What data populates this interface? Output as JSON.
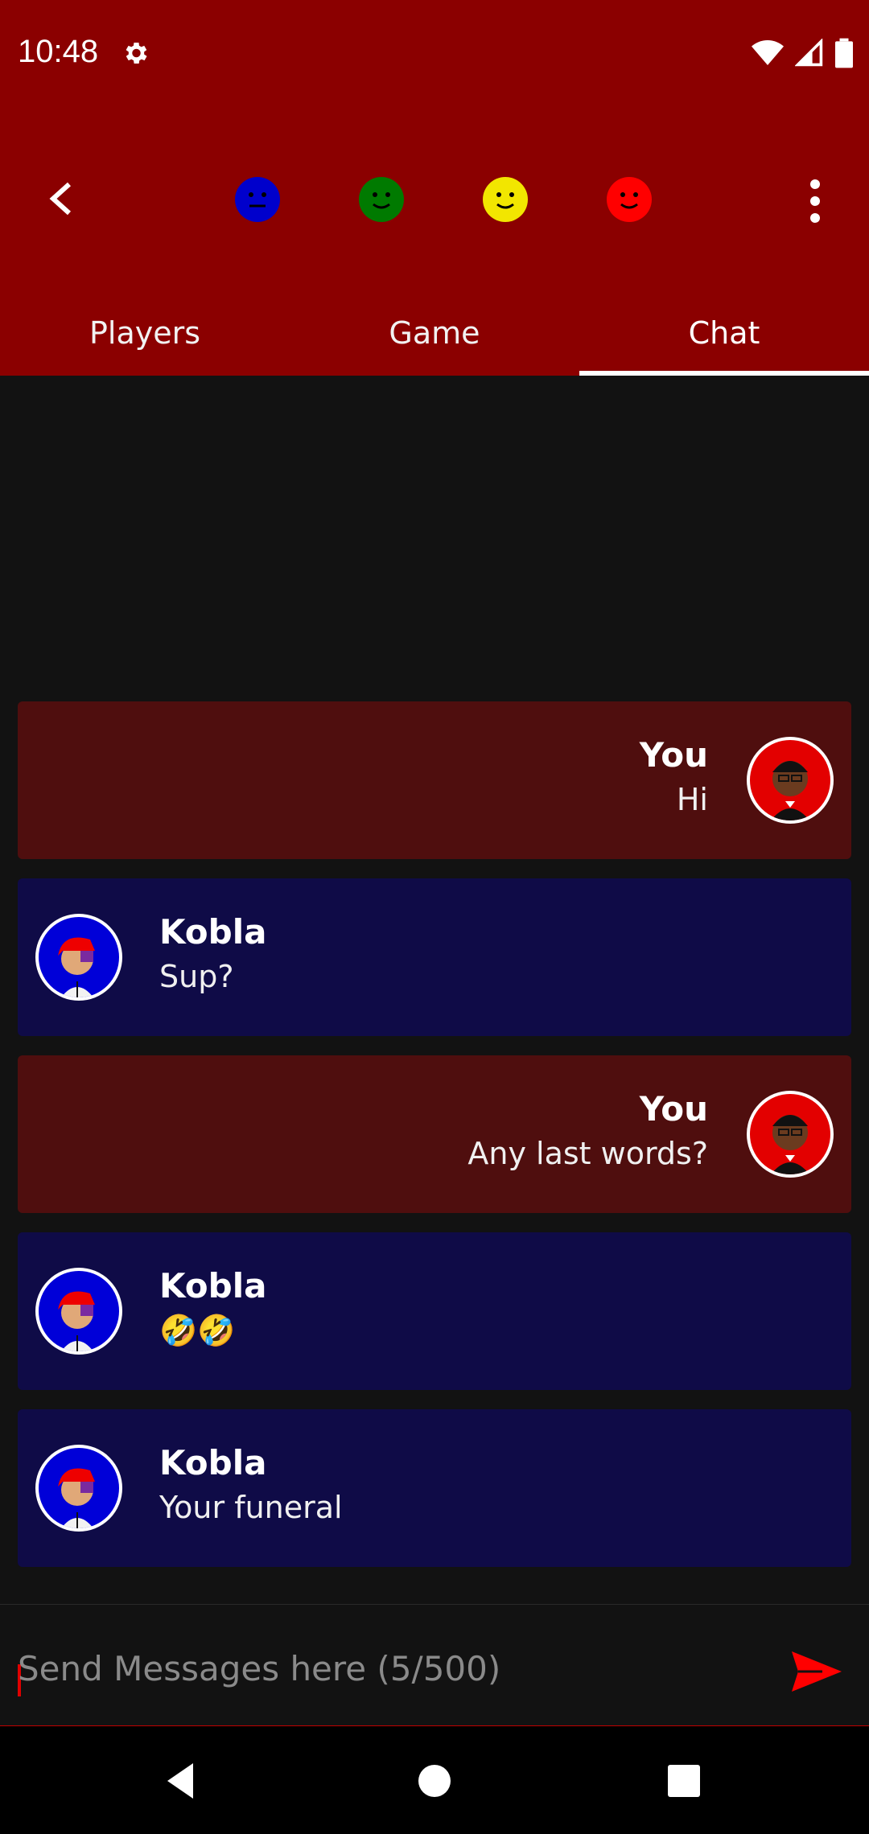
{
  "status_bar": {
    "time": "10:48"
  },
  "toolbar": {
    "faces": [
      {
        "color": "#0000cc",
        "expression": "neutral"
      },
      {
        "color": "#007a00",
        "expression": "smile"
      },
      {
        "color": "#f2e600",
        "expression": "smile"
      },
      {
        "color": "#ff0000",
        "expression": "smile"
      }
    ]
  },
  "tabs": [
    {
      "label": "Players"
    },
    {
      "label": "Game"
    },
    {
      "label": "Chat",
      "active": true
    }
  ],
  "messages": [
    {
      "from": "me",
      "sender": "You",
      "text": "Hi"
    },
    {
      "from": "them",
      "sender": "Kobla",
      "text": "Sup?"
    },
    {
      "from": "me",
      "sender": "You",
      "text": "Any last words?"
    },
    {
      "from": "them",
      "sender": "Kobla",
      "text": "🤣🤣"
    },
    {
      "from": "them",
      "sender": "Kobla",
      "text": "Your funeral"
    }
  ],
  "composer": {
    "placeholder": "Send Messages here (5/500)"
  },
  "colors": {
    "accent": "#8b0000",
    "my_bubble": "#4f0e0e",
    "their_bubble": "#0f0b47"
  }
}
